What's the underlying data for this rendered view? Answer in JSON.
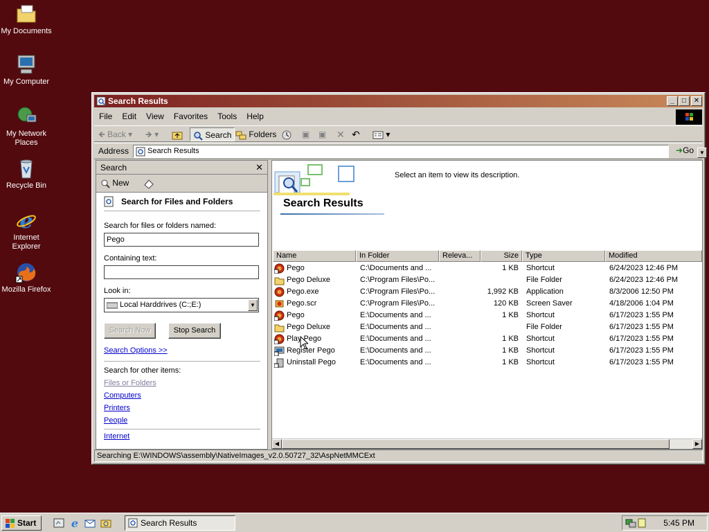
{
  "desktop": {
    "icons": [
      {
        "label_line1": "My Documents",
        "label_line2": "",
        "icon": "folder-documents-icon"
      },
      {
        "label_line1": "My Computer",
        "label_line2": "",
        "icon": "computer-icon"
      },
      {
        "label_line1": "My Network",
        "label_line2": "Places",
        "icon": "network-icon"
      },
      {
        "label_line1": "Recycle Bin",
        "label_line2": "",
        "icon": "recycle-bin-icon"
      },
      {
        "label_line1": "Internet",
        "label_line2": "Explorer",
        "icon": "internet-explorer-icon"
      },
      {
        "label_line1": "Mozilla Firefox",
        "label_line2": "",
        "icon": "firefox-icon"
      }
    ],
    "background_color": "#520a0e"
  },
  "window": {
    "title": "Search Results",
    "menu": [
      "File",
      "Edit",
      "View",
      "Favorites",
      "Tools",
      "Help"
    ],
    "toolbar": {
      "back": "Back",
      "search": "Search",
      "folders": "Folders"
    },
    "address": {
      "label": "Address",
      "value": "Search Results",
      "go": "Go"
    },
    "status": "Searching E:\\WINDOWS\\assembly\\NativeImages_v2.0.50727_32\\AspNetMMCExt"
  },
  "search_pane": {
    "header": "Search",
    "close": "✕",
    "new_label": "New",
    "title": "Search for Files and Folders",
    "named_label": "Search for files or folders named:",
    "named_value": "Pego",
    "containing_label": "Containing text:",
    "containing_value": "",
    "look_in_label": "Look in:",
    "look_in_value": "Local Harddrives (C:;E:)",
    "search_now": "Search Now",
    "stop_search": "Stop Search",
    "search_options": "Search Options >>",
    "other_items_label": "Search for other items:",
    "other_items": [
      "Files or Folders",
      "Computers",
      "Printers",
      "People"
    ],
    "internet": "Internet"
  },
  "results_pane": {
    "description": "Select an item to view its description.",
    "title": "Search Results",
    "columns": [
      "Name",
      "In Folder",
      "Releva...",
      "Size",
      "Type",
      "Modified"
    ],
    "rows": [
      {
        "name": "Pego",
        "folder": "C:\\Documents and ...",
        "size": "1 KB",
        "type": "Shortcut",
        "modified": "6/24/2023 12:46 PM",
        "icon": "pego-shortcut-icon"
      },
      {
        "name": "Pego Deluxe",
        "folder": "C:\\Program Files\\Po...",
        "size": "",
        "type": "File Folder",
        "modified": "6/24/2023 12:46 PM",
        "icon": "folder-icon"
      },
      {
        "name": "Pego.exe",
        "folder": "C:\\Program Files\\Po...",
        "size": "1,992 KB",
        "type": "Application",
        "modified": "8/3/2006 12:50 PM",
        "icon": "pego-app-icon"
      },
      {
        "name": "Pego.scr",
        "folder": "C:\\Program Files\\Po...",
        "size": "120 KB",
        "type": "Screen Saver",
        "modified": "4/18/2006 1:04 PM",
        "icon": "screensaver-icon"
      },
      {
        "name": "Pego",
        "folder": "E:\\Documents and ...",
        "size": "1 KB",
        "type": "Shortcut",
        "modified": "6/17/2023 1:55 PM",
        "icon": "pego-shortcut-icon"
      },
      {
        "name": "Pego Deluxe",
        "folder": "E:\\Documents and ...",
        "size": "",
        "type": "File Folder",
        "modified": "6/17/2023 1:55 PM",
        "icon": "folder-icon"
      },
      {
        "name": "Play Pego",
        "folder": "E:\\Documents and ...",
        "size": "1 KB",
        "type": "Shortcut",
        "modified": "6/17/2023 1:55 PM",
        "icon": "pego-shortcut-icon"
      },
      {
        "name": "Register Pego",
        "folder": "E:\\Documents and ...",
        "size": "1 KB",
        "type": "Shortcut",
        "modified": "6/17/2023 1:55 PM",
        "icon": "register-icon"
      },
      {
        "name": "Uninstall Pego",
        "folder": "E:\\Documents and ...",
        "size": "1 KB",
        "type": "Shortcut",
        "modified": "6/17/2023 1:55 PM",
        "icon": "uninstall-icon"
      }
    ]
  },
  "taskbar": {
    "start": "Start",
    "task": "Search Results",
    "clock": "5:45 PM"
  }
}
